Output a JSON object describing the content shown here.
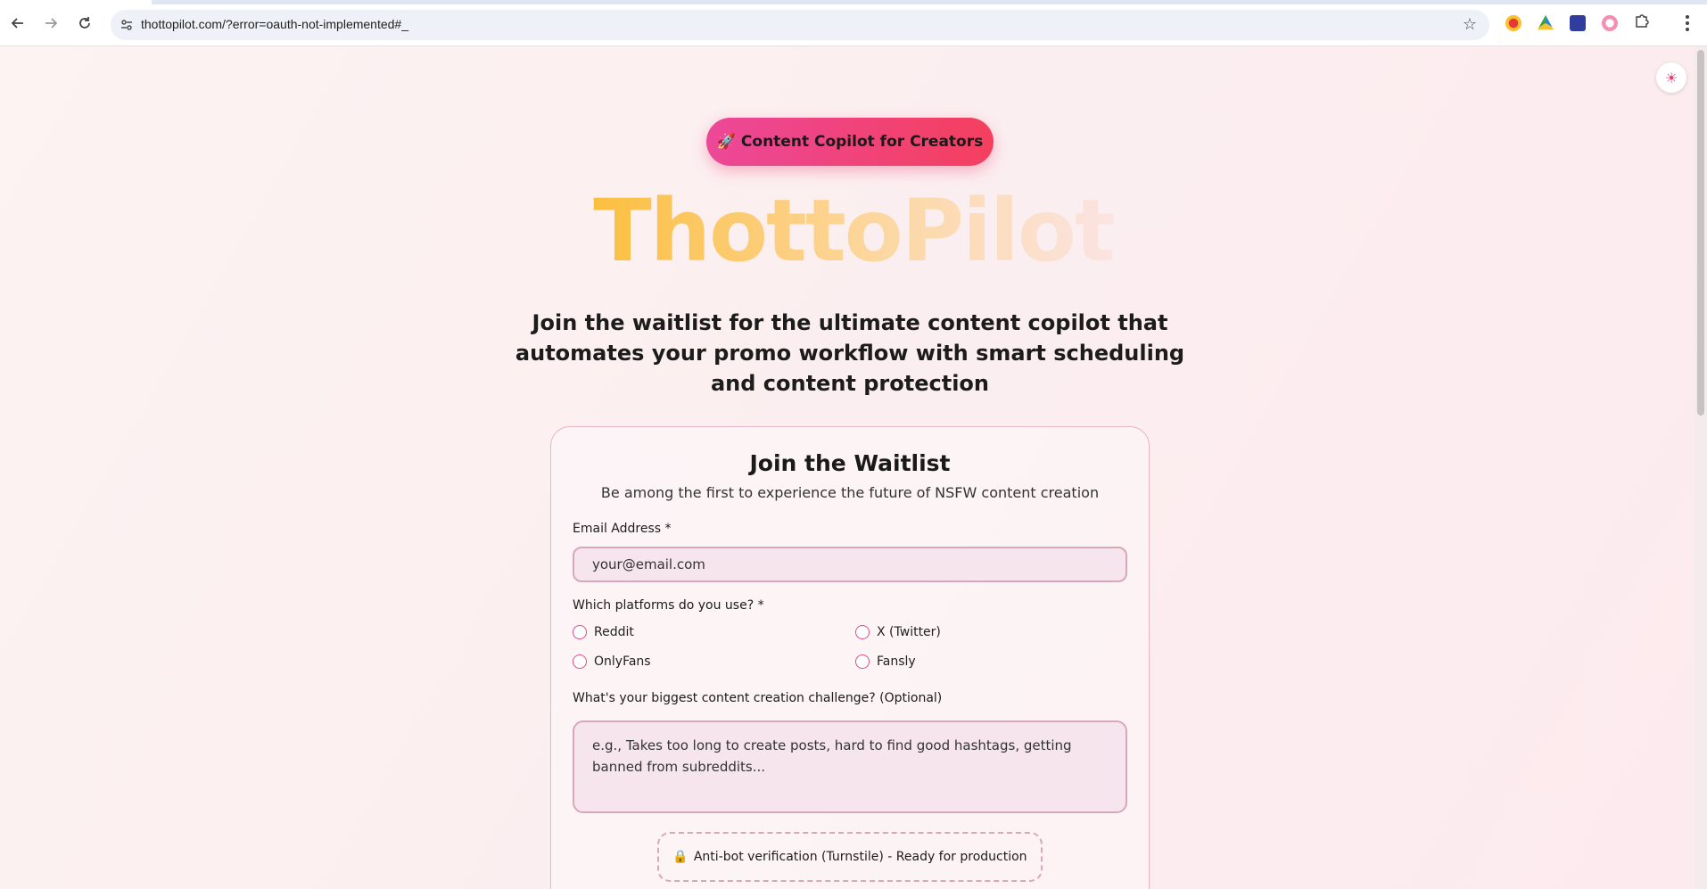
{
  "browser": {
    "url": "thottopilot.com/?error=oauth-not-implemented#_",
    "back_icon": "arrow-left-icon",
    "forward_icon": "arrow-right-icon",
    "reload_icon": "reload-icon",
    "site_info_icon": "tune-icon",
    "star_icon": "star-icon",
    "extensions_icon": "puzzle-icon",
    "menu_icon": "kebab-menu-icon"
  },
  "theme_toggle": {
    "icon": "sun-icon",
    "glyph": "☀"
  },
  "hero": {
    "badge_emoji": "🚀",
    "badge_text": "Content Copilot for Creators",
    "brand": "ThottoPilot",
    "tagline": "Join the waitlist for the ultimate content copilot that automates your promo workflow with smart scheduling and content protection"
  },
  "waitlist": {
    "title": "Join the Waitlist",
    "subtitle": "Be among the first to experience the future of NSFW content creation",
    "email_label": "Email Address *",
    "email_placeholder": "your@email.com",
    "platforms_label": "Which platforms do you use? *",
    "platforms": [
      {
        "label": "Reddit",
        "selected": false
      },
      {
        "label": "X (Twitter)",
        "selected": false
      },
      {
        "label": "OnlyFans",
        "selected": false
      },
      {
        "label": "Fansly",
        "selected": false
      }
    ],
    "challenge_label": "What's your biggest content creation challenge? (Optional)",
    "challenge_placeholder": "e.g., Takes too long to create posts, hard to find good hashtags, getting banned from subreddits...",
    "turnstile_emoji": "🔒",
    "turnstile_text": "Anti-bot verification (Turnstile) - Ready for production"
  },
  "colors": {
    "accent_pink": "#ec4899",
    "accent_rose": "#f43f5e",
    "brand_gold": "#fbbf3f",
    "page_bg": "#fbeef0"
  }
}
